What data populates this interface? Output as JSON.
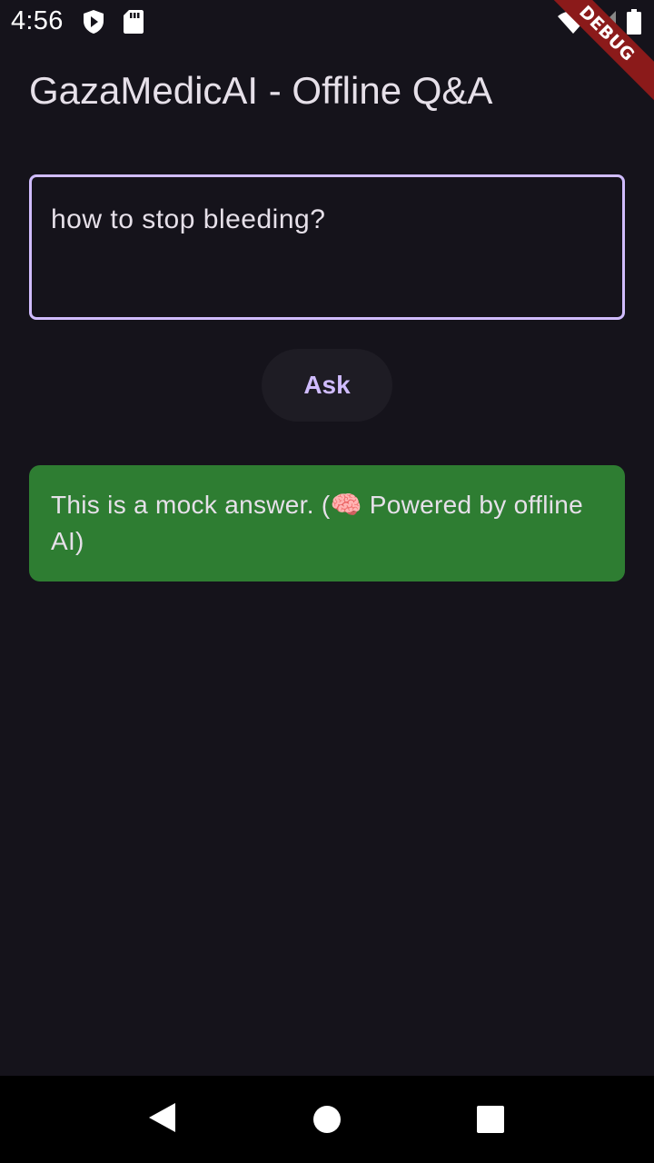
{
  "status_bar": {
    "time": "4:56",
    "icons": [
      "play-protect-icon",
      "sd-card-icon",
      "wifi-icon",
      "cell-signal-icon",
      "battery-icon"
    ]
  },
  "debug_banner": "DEBUG",
  "page": {
    "title": "GazaMedicAI - Offline Q&A"
  },
  "question": {
    "value": "how to stop bleeding?"
  },
  "ask_button": {
    "label": "Ask"
  },
  "answer": {
    "text": "This is a mock answer. (🧠 Powered by offline AI)"
  },
  "nav": {
    "icons": [
      "back-icon",
      "home-icon",
      "recents-icon"
    ]
  },
  "colors": {
    "background": "#15131b",
    "accent": "#d0bcff",
    "answer_bg": "#2e7d32",
    "debug_banner": "#8b1a1a"
  }
}
